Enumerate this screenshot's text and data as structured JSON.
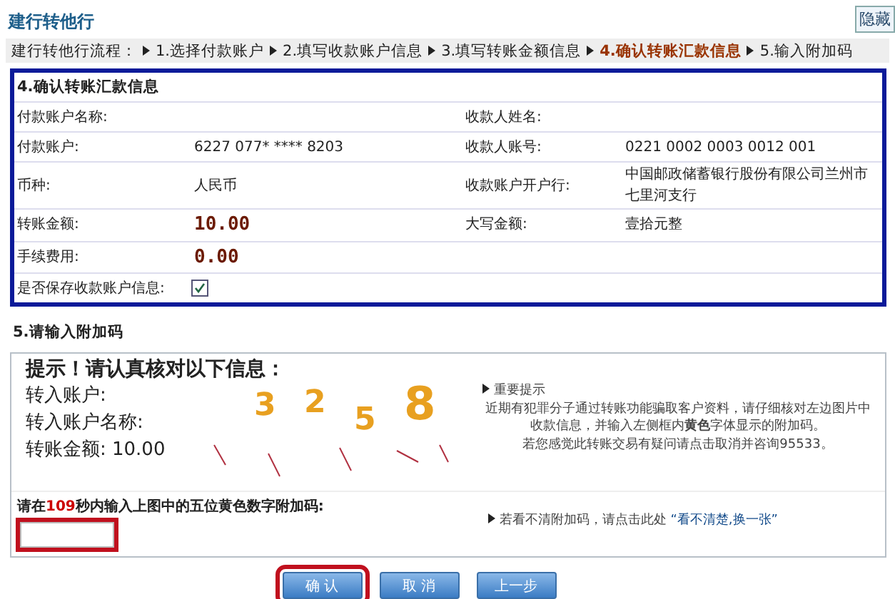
{
  "page_title": "建行转他行",
  "hide_button": "隐藏",
  "steps": {
    "label": "建行转他行流程：",
    "items": [
      {
        "label": "1.选择付款账户",
        "selected": false
      },
      {
        "label": "2.填写收款账户信息",
        "selected": false
      },
      {
        "label": "3.填写转账金额信息",
        "selected": false
      },
      {
        "label": "4.确认转账汇款信息",
        "selected": true
      },
      {
        "label": "5.输入附加码",
        "selected": false
      }
    ]
  },
  "confirm": {
    "title": "4.确认转账汇款信息",
    "rows": [
      {
        "label": "付款账户名称:",
        "value": "",
        "label2": "收款人姓名:",
        "value2": ""
      },
      {
        "label": "付款账户:",
        "value": "6227 077* **** 8203",
        "label2": "收款人账号:",
        "value2": "0221 0002 0003 0012 001"
      },
      {
        "label": "币种:",
        "value": "人民币",
        "label2": "收款账户开户行:",
        "value2": "中国邮政储蓄银行股份有限公司兰州市七里河支行"
      },
      {
        "label": "转账金额:",
        "value": "10.00",
        "amount": true,
        "label2": "大写金额:",
        "value2": "壹拾元整"
      },
      {
        "label": "手续费用:",
        "value": "0.00",
        "amount": true
      }
    ],
    "save": {
      "label": "是否保存收款账户信息:",
      "checked": true
    }
  },
  "code": {
    "title": "5.请输入附加码",
    "captcha": {
      "heading": "提示！请认真核对以下信息：",
      "lines": [
        "转入账户:",
        "转入账户名称:",
        "转账金额: 10.00"
      ],
      "digits": [
        "3",
        "2",
        "5",
        "8"
      ]
    },
    "notice": {
      "title": "重要提示",
      "lines": [
        "近期有犯罪分子通过转账功能骗取客户资料，请仔细核对左边图片中收款信息，并输入左侧框内**黄色**字体显示的附加码。",
        "若您感觉此转账交易有疑问请点击取消并咨询95533。"
      ]
    },
    "prompt_before": "请在",
    "seconds": "109",
    "prompt_after": "秒内输入上图中的五位黄色数字附加码:",
    "refresh_hint": "若看不清附加码，请点击此处",
    "refresh_link": "“看不清楚,换一张”"
  },
  "buttons": [
    "确 认",
    "取 消",
    "上一步"
  ]
}
